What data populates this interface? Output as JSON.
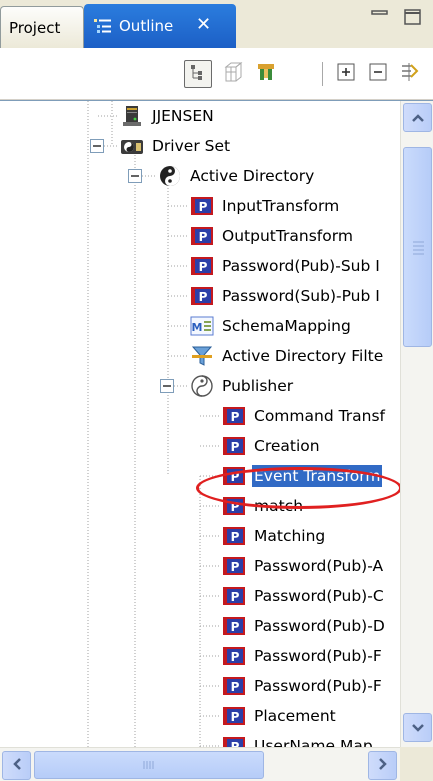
{
  "tabs": [
    {
      "label": "Project",
      "active": false
    },
    {
      "label": "Outline",
      "active": true
    }
  ],
  "tab_close_glyph": "✕",
  "toolbar": {
    "buttons": [
      {
        "icon": "hierarchy-view-icon",
        "pressed": true
      },
      {
        "icon": "hide-fields-icon",
        "pressed": false
      },
      {
        "icon": "filter-icon",
        "pressed": false
      },
      {
        "icon": "expand-all-icon",
        "pressed": false
      },
      {
        "icon": "collapse-all-icon",
        "pressed": false
      },
      {
        "icon": "link-with-editor-icon",
        "pressed": false
      }
    ]
  },
  "tree": {
    "items": [
      {
        "label": "JJENSEN",
        "level": 2,
        "icon": "server-icon"
      },
      {
        "label": "Driver Set",
        "level": 2,
        "icon": "driver-set-icon",
        "expanded": true
      },
      {
        "label": "Active Directory",
        "level": 3,
        "icon": "driver-icon",
        "expanded": true
      },
      {
        "label": "InputTransform",
        "level": 4,
        "icon": "policy-icon"
      },
      {
        "label": "OutputTransform",
        "level": 4,
        "icon": "policy-icon"
      },
      {
        "label": "Password(Pub)-Sub I",
        "level": 4,
        "icon": "policy-icon"
      },
      {
        "label": "Password(Sub)-Pub I",
        "level": 4,
        "icon": "policy-icon"
      },
      {
        "label": "SchemaMapping",
        "level": 4,
        "icon": "schema-mapping-icon"
      },
      {
        "label": "Active Directory Filte",
        "level": 4,
        "icon": "filter-icon"
      },
      {
        "label": "Publisher",
        "level": 4,
        "icon": "publisher-icon",
        "expanded": true
      },
      {
        "label": "Command Transf",
        "level": 5,
        "icon": "policy-icon"
      },
      {
        "label": "Creation",
        "level": 5,
        "icon": "policy-icon"
      },
      {
        "label": "Event Transform",
        "level": 5,
        "icon": "policy-icon",
        "selected": true
      },
      {
        "label": "match",
        "level": 5,
        "icon": "policy-icon"
      },
      {
        "label": "Matching",
        "level": 5,
        "icon": "policy-icon"
      },
      {
        "label": "Password(Pub)-A",
        "level": 5,
        "icon": "policy-icon"
      },
      {
        "label": "Password(Pub)-C",
        "level": 5,
        "icon": "policy-icon"
      },
      {
        "label": "Password(Pub)-D",
        "level": 5,
        "icon": "policy-icon"
      },
      {
        "label": "Password(Pub)-F",
        "level": 5,
        "icon": "policy-icon"
      },
      {
        "label": "Password(Pub)-F",
        "level": 5,
        "icon": "policy-icon"
      },
      {
        "label": "Placement",
        "level": 5,
        "icon": "policy-icon"
      },
      {
        "label": "UserName Map",
        "level": 5,
        "icon": "policy-icon"
      }
    ]
  },
  "colors": {
    "selection": "#316ac5",
    "active_tab": "#1f66cf",
    "highlight_ring": "#e02020",
    "policy_icon_red": "#c4191f",
    "policy_icon_blue": "#2c3fa8"
  }
}
